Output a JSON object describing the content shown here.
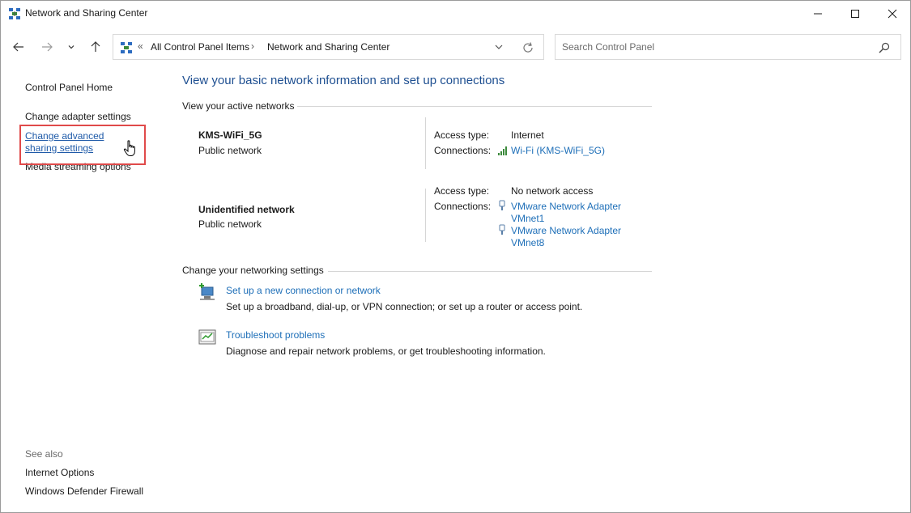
{
  "window": {
    "title": "Network and Sharing Center",
    "app_icon": "network-center-icon",
    "controls": [
      "minimize-icon",
      "maximize-icon",
      "close-icon"
    ]
  },
  "navigation": {
    "back_icon": "back-arrow-icon",
    "forward_icon": "forward-arrow-icon",
    "recent_icon": "chevron-down-icon",
    "up_icon": "up-arrow-icon"
  },
  "address_bar": {
    "prefix": "«",
    "crumbs": [
      "All Control Panel Items",
      "Network and Sharing Center"
    ],
    "separator": "›"
  },
  "search": {
    "placeholder": "Search Control Panel"
  },
  "sidebar": {
    "home": "Control Panel Home",
    "links": [
      "Change adapter settings",
      "Change advanced sharing settings",
      "Media streaming options"
    ],
    "see_also_heading": "See also",
    "see_also": [
      "Internet Options",
      "Windows Defender Firewall"
    ]
  },
  "main": {
    "title": "View your basic network information and set up connections",
    "active_heading": "View your active networks",
    "networks": [
      {
        "name": "KMS-WiFi_5G",
        "type": "Public network",
        "access_label": "Access type:",
        "access_value": "Internet",
        "connections_label": "Connections:",
        "connections": [
          "Wi-Fi (KMS-WiFi_5G)"
        ]
      },
      {
        "name": "Unidentified network",
        "type": "Public network",
        "access_label": "Access type:",
        "access_value": "No network access",
        "connections_label": "Connections:",
        "connections": [
          "VMware Network Adapter VMnet1",
          "VMware Network Adapter VMnet8"
        ]
      }
    ],
    "settings_heading": "Change your networking settings",
    "tasks": [
      {
        "link": "Set up a new connection or network",
        "desc": "Set up a broadband, dial-up, or VPN connection; or set up a router or access point."
      },
      {
        "link": "Troubleshoot problems",
        "desc": "Diagnose and repair network problems, or get troubleshooting information."
      }
    ]
  },
  "colors": {
    "link": "#1e6fb8",
    "title": "#1e4f91",
    "highlight": "#e04a4a"
  }
}
